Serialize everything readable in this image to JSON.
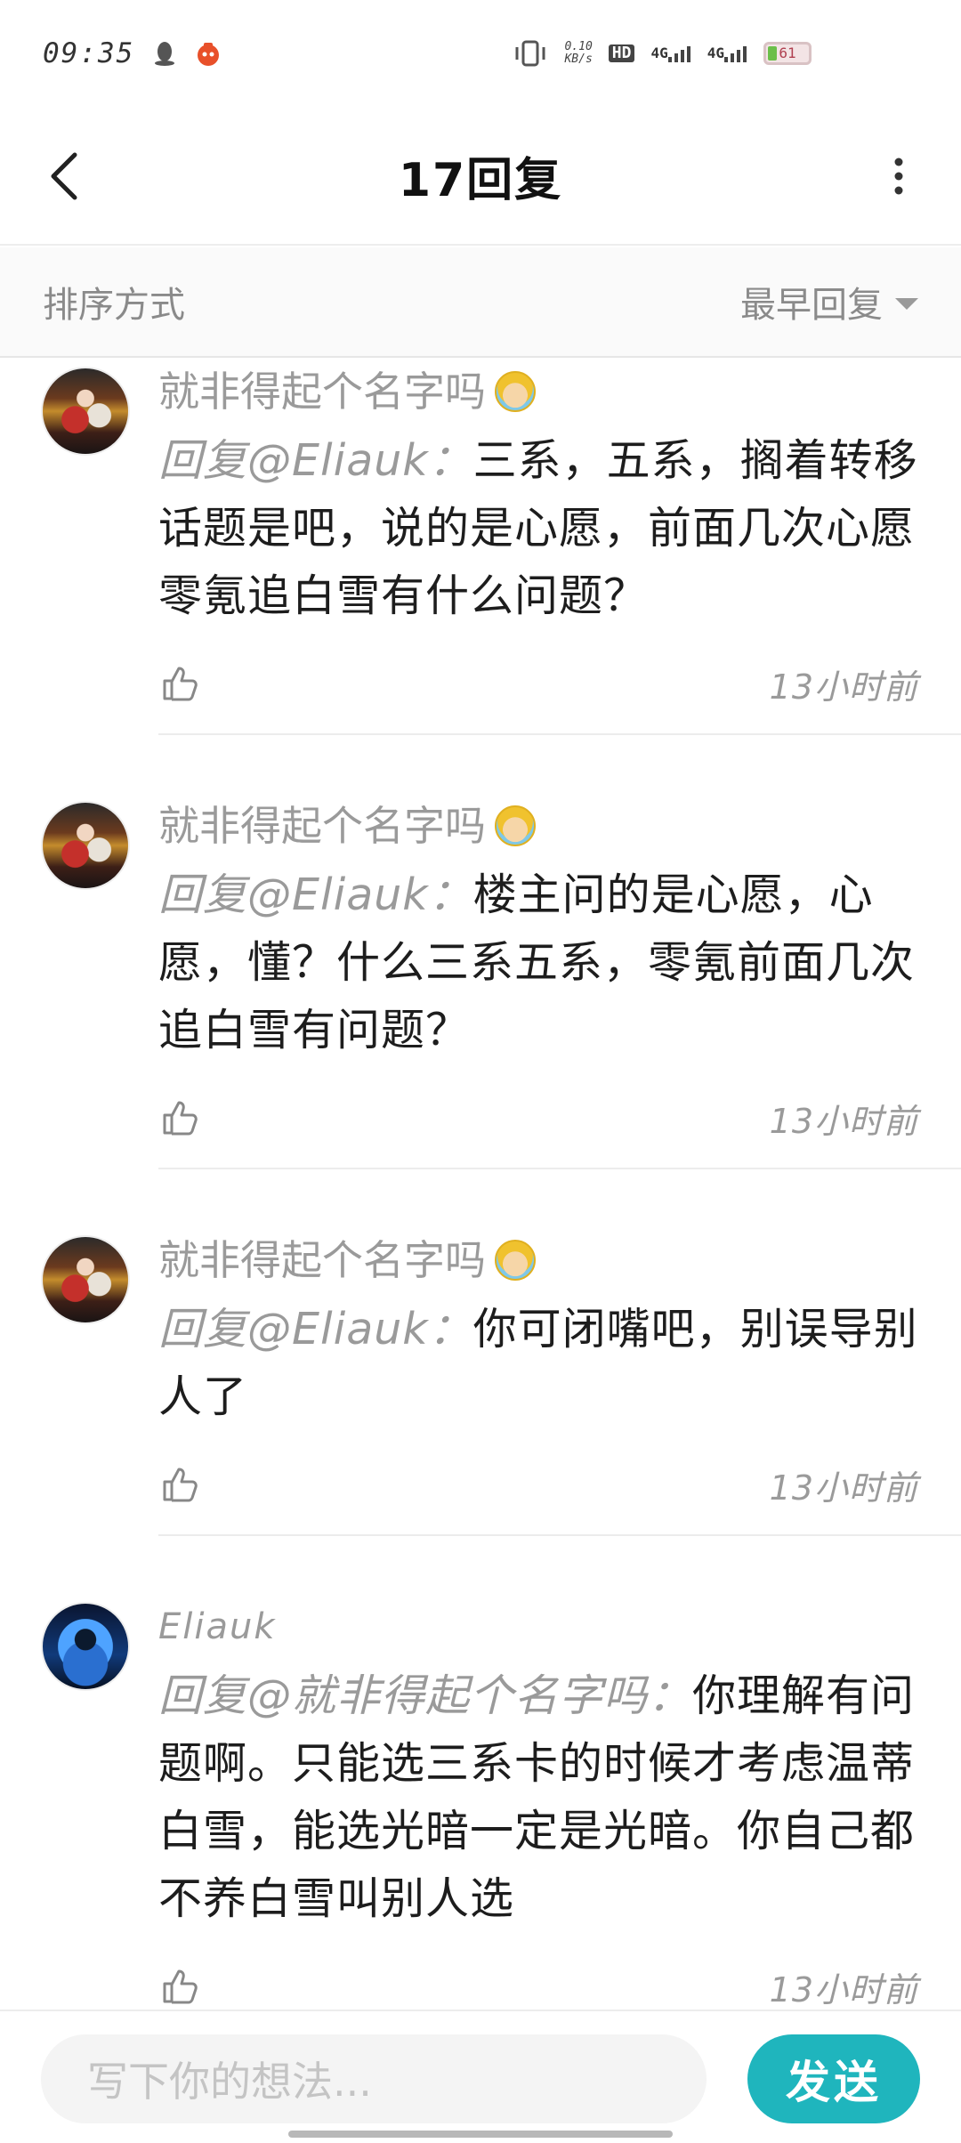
{
  "status_bar": {
    "time": "09:35",
    "net_speed_value": "0.10",
    "net_speed_unit": "KB/s",
    "hd_label": "HD",
    "sim1_label": "4G",
    "sim2_label": "4G",
    "battery": "61"
  },
  "header": {
    "title": "17回复"
  },
  "sort_bar": {
    "label": "排序方式",
    "value": "最早回复"
  },
  "comments": [
    {
      "username": "就非得起个名字吗",
      "mention": "回复@Eliauk：",
      "text": "三系，五系，搁着转移话题是吧，说的是心愿，前面几次心愿零氪追白雪有什么问题？",
      "time": "13小时前"
    },
    {
      "username": "就非得起个名字吗",
      "mention": "回复@Eliauk：",
      "text": "楼主问的是心愿，心愿，懂？什么三系五系，零氪前面几次追白雪有问题？",
      "time": "13小时前"
    },
    {
      "username": "就非得起个名字吗",
      "mention": "回复@Eliauk：",
      "text": "你可闭嘴吧，别误导别人了",
      "time": "13小时前"
    },
    {
      "username": "Eliauk",
      "mention": "回复@就非得起个名字吗：",
      "text": "你理解有问题啊。只能选三系卡的时候才考虑温蒂白雪，能选光暗一定是光暗。你自己都不养白雪叫别人选",
      "time": "13小时前"
    }
  ],
  "composer": {
    "placeholder": "写下你的想法...",
    "send_label": "发送"
  },
  "colors": {
    "accent": "#1fb5bd",
    "muted_text": "#9a9a9a",
    "divider": "#ececec"
  }
}
